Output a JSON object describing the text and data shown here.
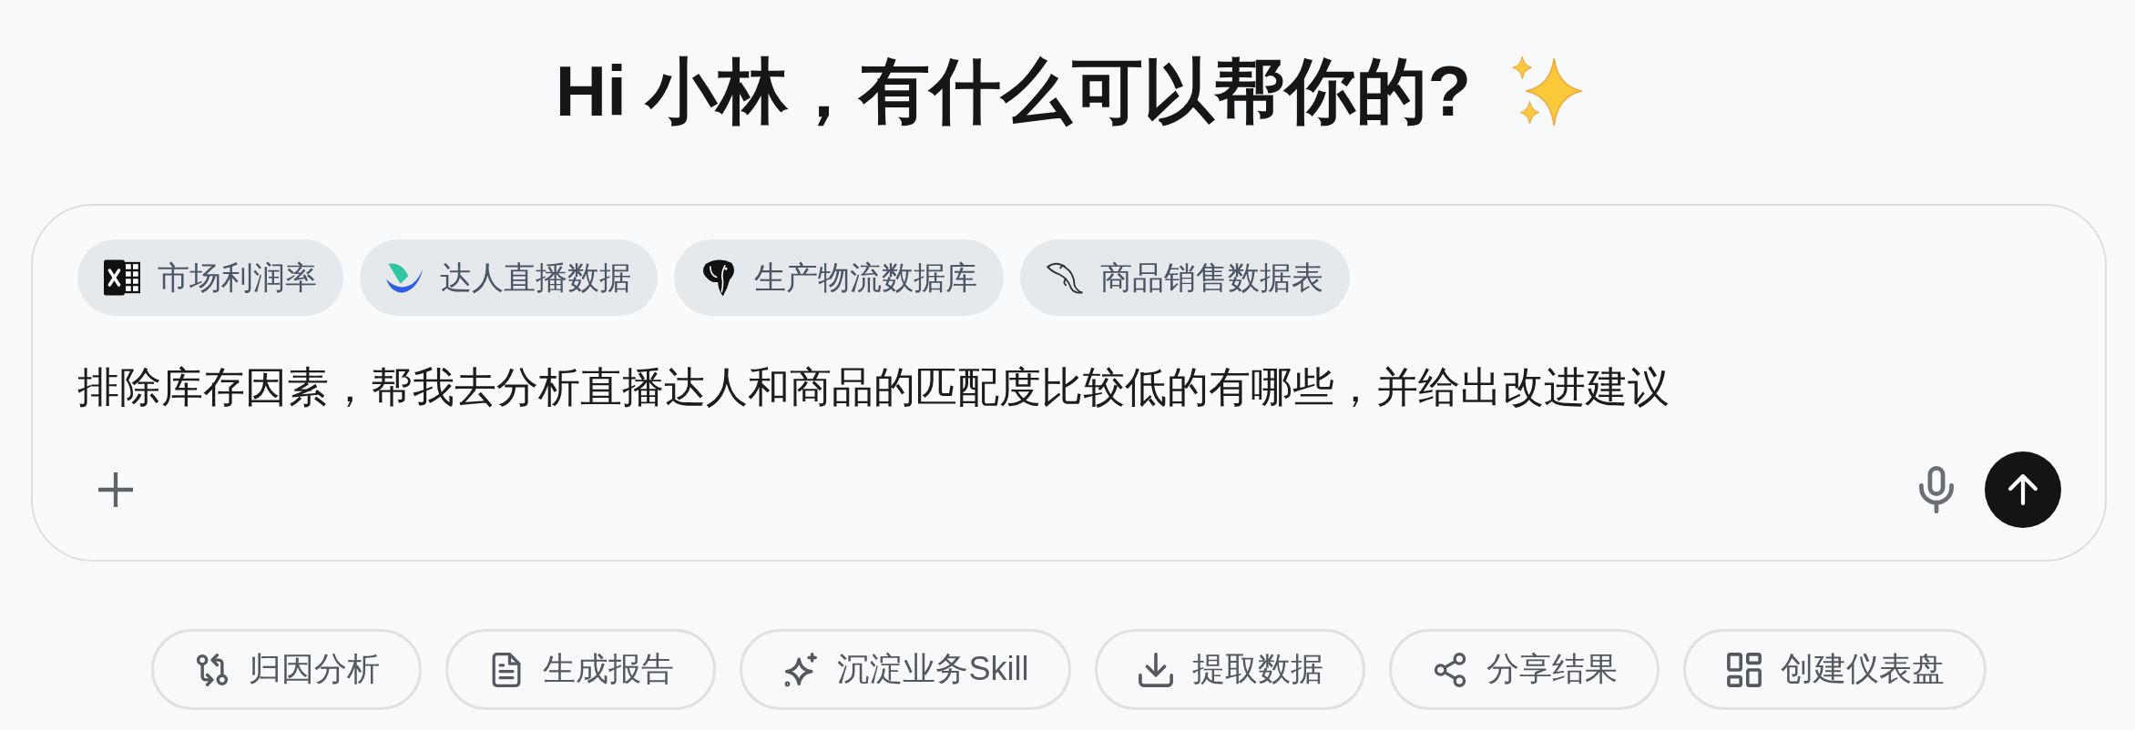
{
  "header": {
    "title": "Hi 小林，有什么可以帮你的?"
  },
  "composer": {
    "sources": [
      {
        "kind": "spreadsheet",
        "label": "市场利润率"
      },
      {
        "kind": "app",
        "label": "达人直播数据"
      },
      {
        "kind": "elephant",
        "label": "生产物流数据库"
      },
      {
        "kind": "dolphin",
        "label": "商品销售数据表"
      }
    ],
    "value": "排除库存因素，帮我去分析直播达人和商品的匹配度比较低的有哪些，并给出改进建议"
  },
  "actions": [
    {
      "kind": "attribution",
      "label": "归因分析"
    },
    {
      "kind": "report",
      "label": "生成报告"
    },
    {
      "kind": "skill",
      "label": "沉淀业务Skill"
    },
    {
      "kind": "extract",
      "label": "提取数据"
    },
    {
      "kind": "share",
      "label": "分享结果"
    },
    {
      "kind": "dashboard",
      "label": "创建仪表盘"
    }
  ]
}
